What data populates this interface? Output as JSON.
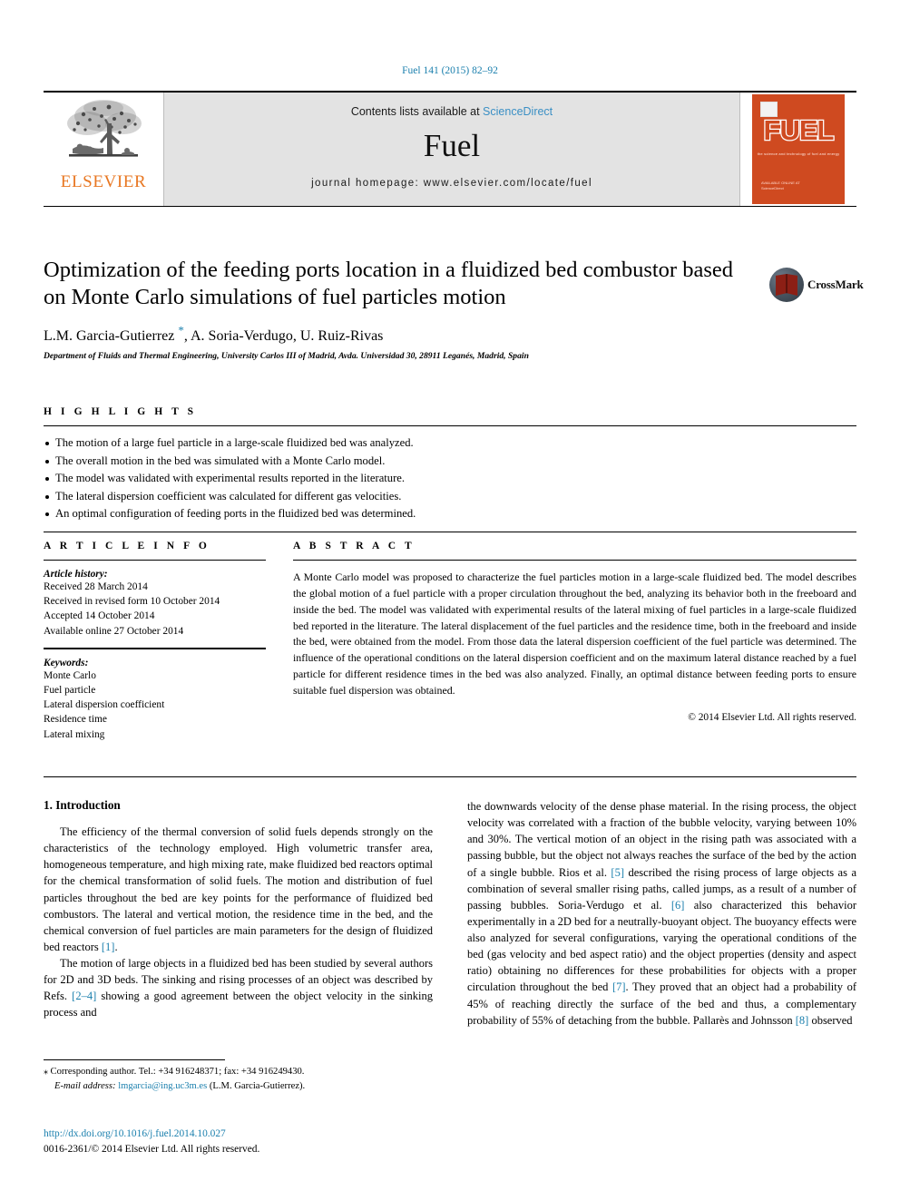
{
  "running_head": "Fuel 141 (2015) 82–92",
  "masthead": {
    "publisher": "ELSEVIER",
    "contents_prefix": "Contents lists available at ",
    "contents_link": "ScienceDirect",
    "journal": "Fuel",
    "homepage": "journal homepage: www.elsevier.com/locate/fuel",
    "cover": {
      "title": "FUEL",
      "subtitle": "the science and technology of fuel and energy",
      "footer": "AVAILABLE ONLINE AT\nScienceDirect"
    }
  },
  "article": {
    "title": "Optimization of the feeding ports location in a fluidized bed combustor based on Monte Carlo simulations of fuel particles motion",
    "authors": "L.M. Garcia-Gutierrez , A. Soria-Verdugo, U. Ruiz-Rivas",
    "corresponding_marker": "*",
    "affiliation": "Department of Fluids and Thermal Engineering, University Carlos III of Madrid, Avda. Universidad 30, 28911 Leganés, Madrid, Spain",
    "crossmark_label": "CrossMark"
  },
  "highlights": {
    "heading": "H I G H L I G H T S",
    "items": [
      "The motion of a large fuel particle in a large-scale fluidized bed was analyzed.",
      "The overall motion in the bed was simulated with a Monte Carlo model.",
      "The model was validated with experimental results reported in the literature.",
      "The lateral dispersion coefficient was calculated for different gas velocities.",
      "An optimal configuration of feeding ports in the fluidized bed was determined."
    ]
  },
  "article_info": {
    "heading": "A R T I C L E    I N F O",
    "history_label": "Article history:",
    "history": [
      "Received 28 March 2014",
      "Received in revised form 10 October 2014",
      "Accepted 14 October 2014",
      "Available online 27 October 2014"
    ],
    "keywords_label": "Keywords:",
    "keywords": [
      "Monte Carlo",
      "Fuel particle",
      "Lateral dispersion coefficient",
      "Residence time",
      "Lateral mixing"
    ]
  },
  "abstract": {
    "heading": "A B S T R A C T",
    "text": "A Monte Carlo model was proposed to characterize the fuel particles motion in a large-scale fluidized bed. The model describes the global motion of a fuel particle with a proper circulation throughout the bed, analyzing its behavior both in the freeboard and inside the bed. The model was validated with experimental results of the lateral mixing of fuel particles in a large-scale fluidized bed reported in the literature. The lateral displacement of the fuel particles and the residence time, both in the freeboard and inside the bed, were obtained from the model. From those data the lateral dispersion coefficient of the fuel particle was determined. The influence of the operational conditions on the lateral dispersion coefficient and on the maximum lateral distance reached by a fuel particle for different residence times in the bed was also analyzed. Finally, an optimal distance between feeding ports to ensure suitable fuel dispersion was obtained.",
    "copyright": "© 2014 Elsevier Ltd. All rights reserved."
  },
  "introduction": {
    "heading": "1. Introduction",
    "left_p1_a": "The efficiency of the thermal conversion of solid fuels depends strongly on the characteristics of the technology employed. High volumetric transfer area, homogeneous temperature, and high mixing rate, make fluidized bed reactors optimal for the chemical transformation of solid fuels. The motion and distribution of fuel particles throughout the bed are key points for the performance of fluidized bed combustors. The lateral and vertical motion, the residence time in the bed, and the chemical conversion of fuel particles are main parameters for the design of fluidized bed reactors ",
    "left_p1_ref": "[1]",
    "left_p1_b": ".",
    "left_p2_a": "The motion of large objects in a fluidized bed has been studied by several authors for 2D and 3D beds. The sinking and rising processes of an object was described by Refs. ",
    "left_p2_ref": "[2–4]",
    "left_p2_b": " showing a good agreement between the object velocity in the sinking process and",
    "right_a": "the downwards velocity of the dense phase material. In the rising process, the object velocity was correlated with a fraction of the bubble velocity, varying between 10% and 30%. The vertical motion of an object in the rising path was associated with a passing bubble, but the object not always reaches the surface of the bed by the action of a single bubble. Rios et al. ",
    "right_ref1": "[5]",
    "right_b": " described the rising process of large objects as a combination of several smaller rising paths, called jumps, as a result of a number of passing bubbles. Soria-Verdugo et al. ",
    "right_ref2": "[6]",
    "right_c": " also characterized this behavior experimentally in a 2D bed for a neutrally-buoyant object. The buoyancy effects were also analyzed for several configurations, varying the operational conditions of the bed (gas velocity and bed aspect ratio) and the object properties (density and aspect ratio) obtaining no differences for these probabilities for objects with a proper circulation throughout the bed ",
    "right_ref3": "[7]",
    "right_d": ". They proved that an object had a probability of 45% of reaching directly the surface of the bed and thus, a complementary probability of 55% of detaching from the bubble. Pallarès and Johnsson ",
    "right_ref4": "[8]",
    "right_e": " observed"
  },
  "footnotes": {
    "corresponding": "Corresponding author. Tel.: +34 916248371; fax: +34 916249430.",
    "email_label": "E-mail address:",
    "email": "lmgarcia@ing.uc3m.es",
    "email_owner": "(L.M. Garcia-Gutierrez)."
  },
  "footer": {
    "doi": "http://dx.doi.org/10.1016/j.fuel.2014.10.027",
    "issn_line": "0016-2361/© 2014 Elsevier Ltd. All rights reserved."
  }
}
